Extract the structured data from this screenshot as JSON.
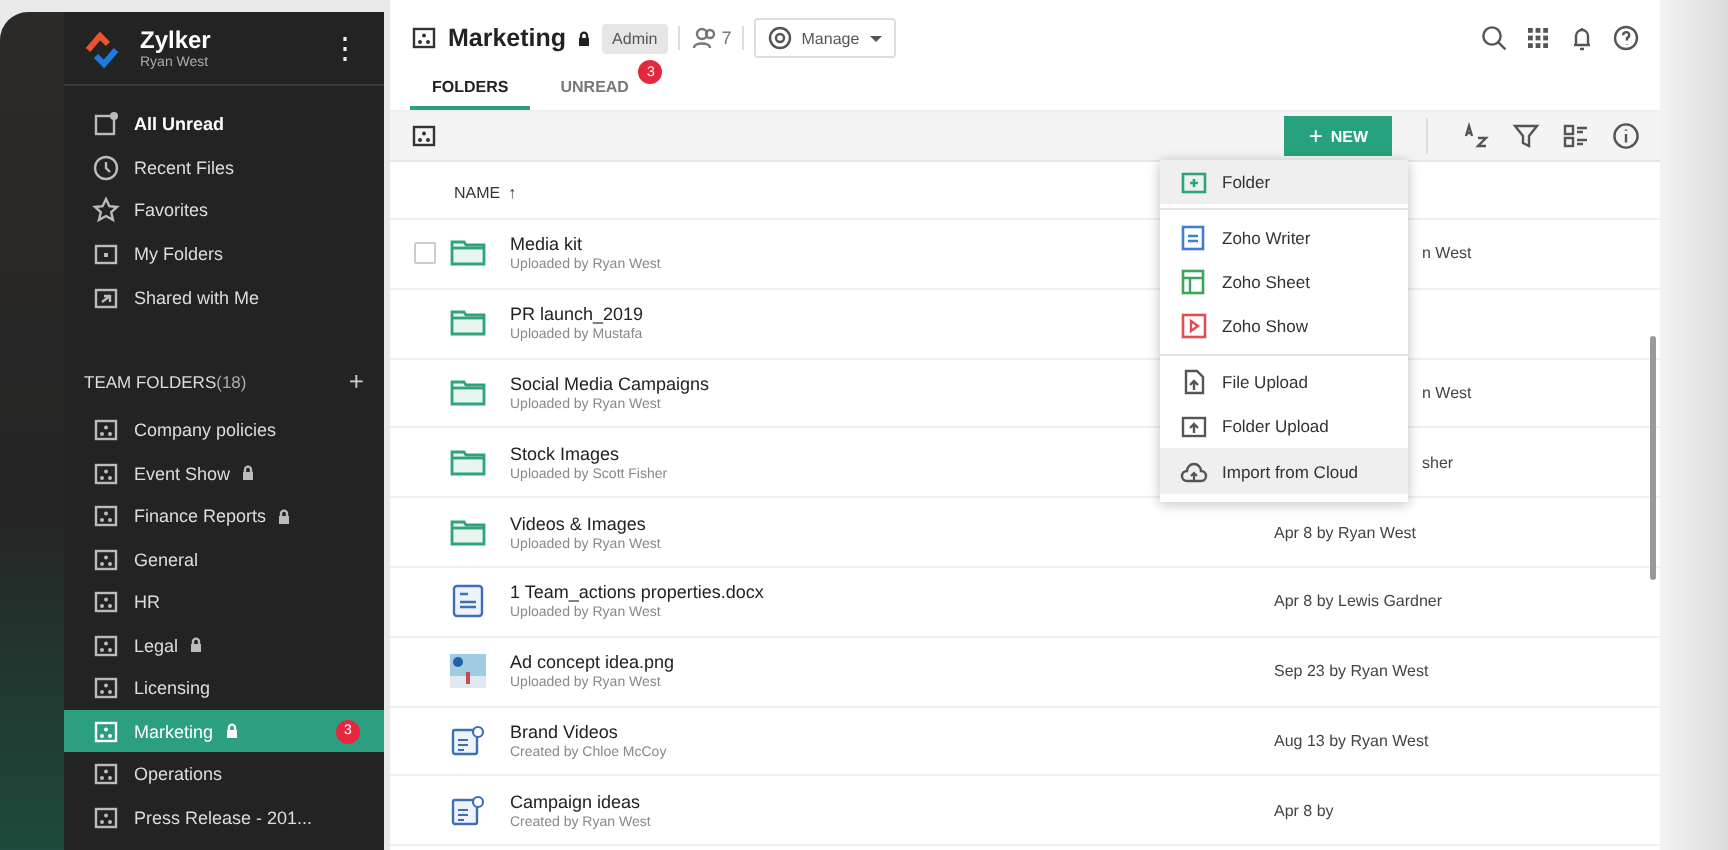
{
  "brand": {
    "name": "Zylker",
    "user": "Ryan West",
    "menu_glyph": "⋮"
  },
  "nav": [
    {
      "kind": "unread",
      "label": "All Unread",
      "bold": true
    },
    {
      "kind": "recent",
      "label": "Recent Files",
      "bold": false
    },
    {
      "kind": "favorites",
      "label": "Favorites",
      "bold": false
    },
    {
      "kind": "folders",
      "label": "My Folders",
      "bold": false
    },
    {
      "kind": "shared",
      "label": "Shared with Me",
      "bold": false
    }
  ],
  "team_folders": {
    "title": "TEAM FOLDERS",
    "count": "(18)",
    "add_glyph": "+",
    "items": [
      {
        "label": "Company policies",
        "locked": false,
        "selected": false
      },
      {
        "label": "Event Show",
        "locked": true,
        "selected": false
      },
      {
        "label": "Finance Reports",
        "locked": true,
        "selected": false
      },
      {
        "label": "General",
        "locked": false,
        "selected": false
      },
      {
        "label": "HR",
        "locked": false,
        "selected": false
      },
      {
        "label": "Legal",
        "locked": true,
        "selected": false
      },
      {
        "label": "Licensing",
        "locked": false,
        "selected": false
      },
      {
        "label": "Marketing",
        "locked": true,
        "selected": true,
        "badge": "3"
      },
      {
        "label": "Operations",
        "locked": false,
        "selected": false
      },
      {
        "label": "Press Release - 201...",
        "locked": false,
        "selected": false
      }
    ]
  },
  "header": {
    "title": "Marketing",
    "locked": true,
    "role": "Admin",
    "members": "7",
    "manage": "Manage"
  },
  "tabs": [
    {
      "label": "FOLDERS",
      "selected": true
    },
    {
      "label": "UNREAD",
      "selected": false,
      "badge": "3"
    }
  ],
  "new_button": {
    "glyph": "+",
    "label": "NEW"
  },
  "table": {
    "name_column": "NAME",
    "sort_glyph": "↑",
    "rows": [
      {
        "kind": "folder",
        "name": "Media kit",
        "sub": "Uploaded by Ryan West",
        "date_cut": "n West",
        "checked": false
      },
      {
        "kind": "folder",
        "name": "PR launch_2019",
        "sub": "Uploaded by Mustafa"
      },
      {
        "kind": "folder",
        "name": "Social Media Campaigns",
        "sub": "Uploaded by Ryan West",
        "date_cut": "n West"
      },
      {
        "kind": "folder",
        "name": "Stock Images",
        "sub": "Uploaded by Scott Fisher",
        "date_cut": "sher"
      },
      {
        "kind": "folder",
        "name": "Videos & Images",
        "sub": "Uploaded by Ryan West",
        "date": "Apr 8 by Ryan West"
      },
      {
        "kind": "document",
        "name": "1 Team_actions properties.docx",
        "sub": "Uploaded by Ryan West",
        "date": "Apr 8 by Lewis Gardner"
      },
      {
        "kind": "image",
        "name": "Ad concept idea.png",
        "sub": "Uploaded by Ryan West",
        "date": "Sep 23 by Ryan West"
      },
      {
        "kind": "note",
        "name": "Brand Videos",
        "sub": "Created by Chloe McCoy",
        "date": "Aug 13 by Ryan West"
      },
      {
        "kind": "note",
        "name": "Campaign ideas",
        "sub": "Created by Ryan West",
        "date": "Apr 8 by"
      }
    ]
  },
  "new_menu": [
    {
      "kind": "folder",
      "label": "Folder",
      "highlighted": true
    },
    {
      "kind": "divider"
    },
    {
      "kind": "writer",
      "label": "Zoho Writer",
      "highlighted": false
    },
    {
      "kind": "sheet",
      "label": "Zoho Sheet",
      "highlighted": false
    },
    {
      "kind": "show",
      "label": "Zoho Show",
      "highlighted": false
    },
    {
      "kind": "divider"
    },
    {
      "kind": "file-upload",
      "label": "File Upload",
      "highlighted": false
    },
    {
      "kind": "folder-upload",
      "label": "Folder Upload",
      "highlighted": false
    },
    {
      "kind": "cloud",
      "label": "Import from Cloud",
      "highlighted": true
    }
  ]
}
